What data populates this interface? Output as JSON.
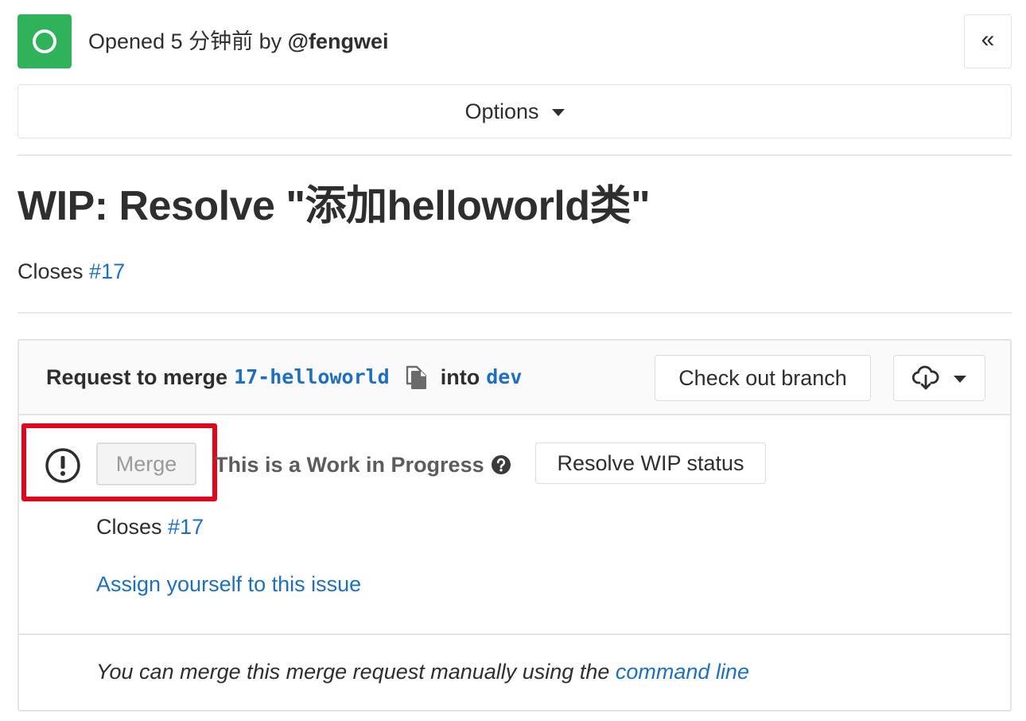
{
  "header": {
    "opened_prefix": "Opened 5 分钟前 by ",
    "author": "@fengwei",
    "collapse_glyph": "«"
  },
  "options": {
    "label": "Options"
  },
  "merge_request": {
    "title": "WIP: Resolve \"添加helloworld类\"",
    "description_prefix": "Closes",
    "description_issue": "#17"
  },
  "widget": {
    "request_prefix": "Request to merge",
    "source_branch": "17-helloworld",
    "into_label": "into",
    "target_branch": "dev",
    "checkout_label": "Check out branch",
    "merge_label": "Merge",
    "wip_text": "This is a Work in Progress",
    "resolve_wip_label": "Resolve WIP status",
    "closes_prefix": "Closes",
    "closes_issue": "#17",
    "assign_label": "Assign yourself to this issue",
    "manual_prefix": "You can merge this merge request manually using the",
    "manual_link": "command line"
  },
  "icons": {
    "status": "open-status-icon",
    "copy": "copy-clipboard-icon",
    "download": "cloud-download-icon",
    "warning": "warning-circle-icon",
    "help": "question-circle-icon"
  },
  "colors": {
    "open_status": "#2eb25a",
    "link": "#1f6fc0",
    "highlight": "#e0061b"
  }
}
